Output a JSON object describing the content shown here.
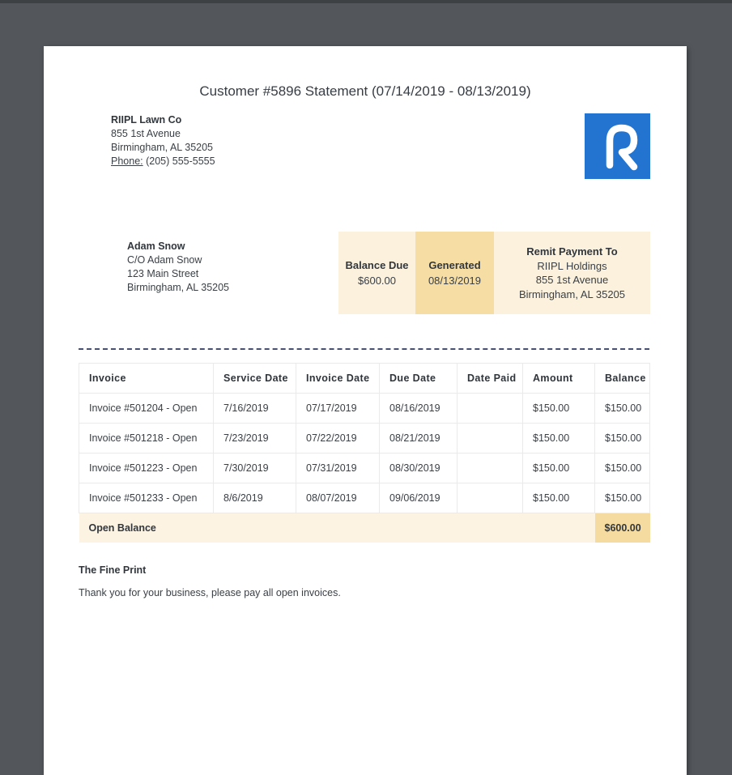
{
  "document": {
    "title": "Customer #5896 Statement (07/14/2019 - 08/13/2019)",
    "company": {
      "name": "RIIPL Lawn Co",
      "address_line1": "855 1st Avenue",
      "address_line2": "Birmingham, AL 35205",
      "phone_label": "Phone:",
      "phone_value": " (205) 555-5555"
    },
    "logo": {
      "letter": "R",
      "brand_color": "#2274d0"
    },
    "customer": {
      "name": "Adam Snow",
      "line1": "C/O Adam Snow",
      "line2": "123 Main Street",
      "line3": "Birmingham, AL 35205"
    },
    "summary": {
      "balance_due_label": "Balance Due",
      "balance_due_value": "$600.00",
      "generated_label": "Generated",
      "generated_value": "08/13/2019",
      "remit_label": "Remit Payment To",
      "remit_line1": "RIIPL Holdings",
      "remit_line2": "855 1st Avenue",
      "remit_line3": "Birmingham, AL 35205",
      "highlight_color": "#fcf1dd",
      "accent_color": "#f6dda3"
    },
    "table": {
      "headers": [
        "Invoice",
        "Service Date",
        "Invoice Date",
        "Due Date",
        "Date Paid",
        "Amount",
        "Balance"
      ],
      "rows": [
        [
          "Invoice #501204 - Open",
          "7/16/2019",
          "07/17/2019",
          "08/16/2019",
          "",
          "$150.00",
          "$150.00"
        ],
        [
          "Invoice #501218 - Open",
          "7/23/2019",
          "07/22/2019",
          "08/21/2019",
          "",
          "$150.00",
          "$150.00"
        ],
        [
          "Invoice #501223 - Open",
          "7/30/2019",
          "07/31/2019",
          "08/30/2019",
          "",
          "$150.00",
          "$150.00"
        ],
        [
          "Invoice #501233 - Open",
          "8/6/2019",
          "08/07/2019",
          "09/06/2019",
          "",
          "$150.00",
          "$150.00"
        ]
      ],
      "footer": {
        "label": "Open Balance",
        "value": "$600.00"
      }
    },
    "fine_print": {
      "heading": "The Fine Print",
      "text": "Thank you for your business, please pay all open invoices."
    }
  }
}
